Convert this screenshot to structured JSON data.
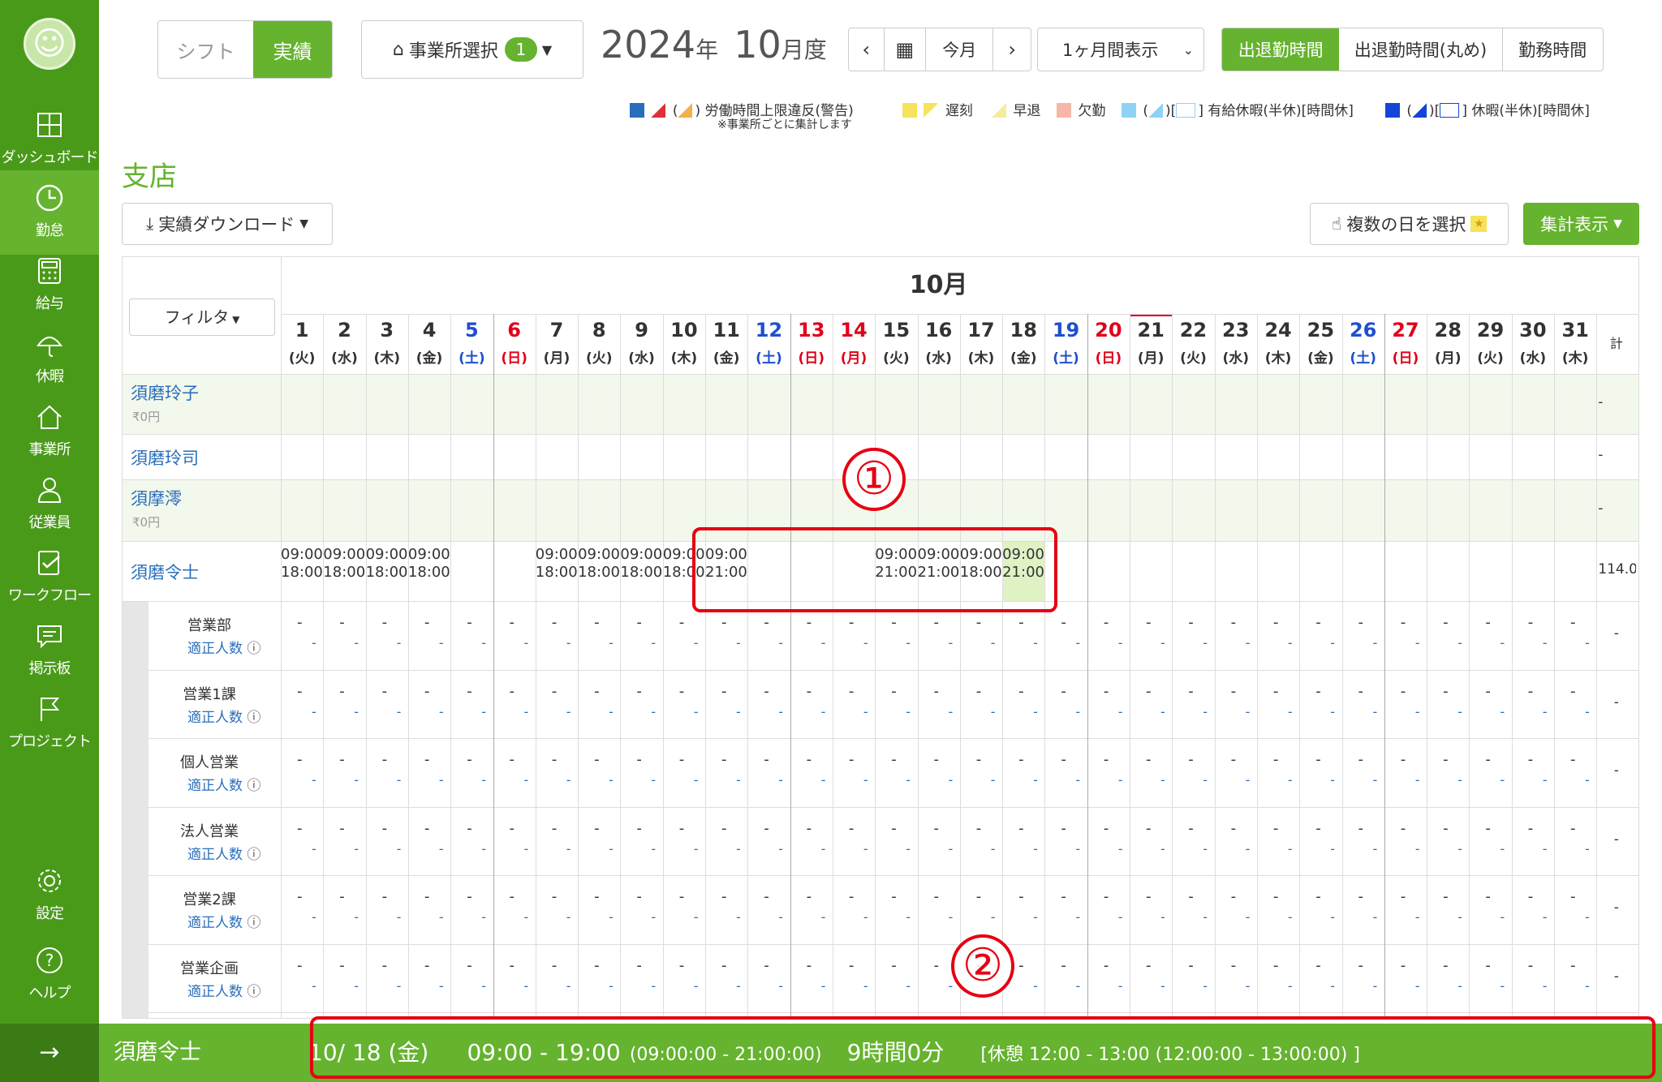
{
  "sidebar": {
    "items": [
      {
        "label": "ダッシュボード",
        "icon": "dashboard-icon"
      },
      {
        "label": "勤怠",
        "icon": "clock-icon",
        "active": true
      },
      {
        "label": "給与",
        "icon": "calculator-icon"
      },
      {
        "label": "休暇",
        "icon": "umbrella-icon"
      },
      {
        "label": "事業所",
        "icon": "home-icon"
      },
      {
        "label": "従業員",
        "icon": "person-icon"
      },
      {
        "label": "ワークフロー",
        "icon": "checklist-icon"
      },
      {
        "label": "掲示板",
        "icon": "message-icon"
      },
      {
        "label": "プロジェクト",
        "icon": "flag-icon"
      },
      {
        "label": "設定",
        "icon": "gear-icon"
      },
      {
        "label": "ヘルプ",
        "icon": "help-icon"
      }
    ],
    "collapse_arrow": "→"
  },
  "header": {
    "mode_tabs": [
      "シフト",
      "実績"
    ],
    "office_select": {
      "label": "事業所選択",
      "count": "1"
    },
    "period": {
      "year": "2024",
      "year_suffix": "年",
      "month": "10",
      "month_suffix": "月度"
    },
    "nav": {
      "prev": "‹",
      "today": "今月",
      "next": "›"
    },
    "range_select": "1ヶ月間表示",
    "time_tabs": [
      "出退勤時間",
      "出退勤時間(丸め)",
      "勤務時間"
    ]
  },
  "legend": {
    "overtime": "労働時間上限違反(警告)",
    "overtime_note": "※事業所ごとに集計します",
    "late": "遅刻",
    "early": "早退",
    "absent": "欠勤",
    "paid_leave": "有給休暇(半休)[時間休]",
    "leave": "休暇(半休)[時間休]",
    "colors": {
      "overtime": "#e0303a",
      "late": "#f6e25c",
      "early": "#f4ee9a",
      "absent": "#f6b6a8",
      "paid": "#8fd2f5",
      "leave": "#1346d8"
    }
  },
  "office_name": "支店",
  "download_btn": "実績ダウンロード",
  "multi_day_btn": "複数の日を選択",
  "summary_btn": "集計表示",
  "table": {
    "month_label": "10月",
    "filter_label": "フィルタ",
    "total_label": "計",
    "days": [
      {
        "d": "1",
        "w": "(火)",
        "c": "n"
      },
      {
        "d": "2",
        "w": "(水)",
        "c": "n"
      },
      {
        "d": "3",
        "w": "(木)",
        "c": "n"
      },
      {
        "d": "4",
        "w": "(金)",
        "c": "n"
      },
      {
        "d": "5",
        "w": "(土)",
        "c": "sat"
      },
      {
        "d": "6",
        "w": "(日)",
        "c": "sun"
      },
      {
        "d": "7",
        "w": "(月)",
        "c": "n"
      },
      {
        "d": "8",
        "w": "(火)",
        "c": "n"
      },
      {
        "d": "9",
        "w": "(水)",
        "c": "n"
      },
      {
        "d": "10",
        "w": "(木)",
        "c": "n"
      },
      {
        "d": "11",
        "w": "(金)",
        "c": "n"
      },
      {
        "d": "12",
        "w": "(土)",
        "c": "sat"
      },
      {
        "d": "13",
        "w": "(日)",
        "c": "sun"
      },
      {
        "d": "14",
        "w": "(月)",
        "c": "sun"
      },
      {
        "d": "15",
        "w": "(火)",
        "c": "n"
      },
      {
        "d": "16",
        "w": "(水)",
        "c": "n"
      },
      {
        "d": "17",
        "w": "(木)",
        "c": "n"
      },
      {
        "d": "18",
        "w": "(金)",
        "c": "n"
      },
      {
        "d": "19",
        "w": "(土)",
        "c": "sat"
      },
      {
        "d": "20",
        "w": "(日)",
        "c": "sun"
      },
      {
        "d": "21",
        "w": "(月)",
        "c": "n"
      },
      {
        "d": "22",
        "w": "(火)",
        "c": "n"
      },
      {
        "d": "23",
        "w": "(水)",
        "c": "n"
      },
      {
        "d": "24",
        "w": "(木)",
        "c": "n"
      },
      {
        "d": "25",
        "w": "(金)",
        "c": "n"
      },
      {
        "d": "26",
        "w": "(土)",
        "c": "sat"
      },
      {
        "d": "27",
        "w": "(日)",
        "c": "sun"
      },
      {
        "d": "28",
        "w": "(月)",
        "c": "n"
      },
      {
        "d": "29",
        "w": "(火)",
        "c": "n"
      },
      {
        "d": "30",
        "w": "(水)",
        "c": "n"
      },
      {
        "d": "31",
        "w": "(木)",
        "c": "n"
      }
    ],
    "employees": [
      {
        "name": "須磨玲子",
        "sub": "₹0円",
        "shaded": true,
        "total": "-",
        "times": {}
      },
      {
        "name": "須磨玲司",
        "sub": "",
        "shaded": false,
        "total": "-",
        "times": {}
      },
      {
        "name": "須摩澪",
        "sub": "₹0円",
        "shaded": true,
        "total": "-",
        "times": {}
      },
      {
        "name": "須磨令士",
        "sub": "",
        "shaded": false,
        "total": "114.0",
        "times": {
          "1": [
            "09:00",
            "18:00"
          ],
          "2": [
            "09:00",
            "18:00"
          ],
          "3": [
            "09:00",
            "18:00"
          ],
          "4": [
            "09:00",
            "18:00"
          ],
          "7": [
            "09:00",
            "18:00"
          ],
          "8": [
            "09:00",
            "18:00"
          ],
          "9": [
            "09:00",
            "18:00"
          ],
          "10": [
            "09:00",
            "18:00"
          ],
          "11": [
            "09:00",
            "21:00"
          ],
          "15": [
            "09:00",
            "21:00"
          ],
          "16": [
            "09:00",
            "21:00"
          ],
          "17": [
            "09:00",
            "18:00"
          ],
          "18": [
            "09:00",
            "21:00"
          ]
        },
        "highlight_day": "18"
      }
    ],
    "departments": [
      "営業部",
      "営業1課",
      "個人営業",
      "法人営業",
      "営業2課",
      "営業企画"
    ],
    "dept_sub": "適正人数",
    "dash": "-"
  },
  "annotations": {
    "one": "①",
    "two": "②"
  },
  "bottom_bar": {
    "name": "須磨令士",
    "date": "10/ 18 (金)",
    "time": "09:00 - 19:00",
    "raw_time": "(09:00:00 - 21:00:00)",
    "duration": "9時間0分",
    "break": "[休憩 12:00 - 13:00 (12:00:00 - 13:00:00) ]"
  }
}
